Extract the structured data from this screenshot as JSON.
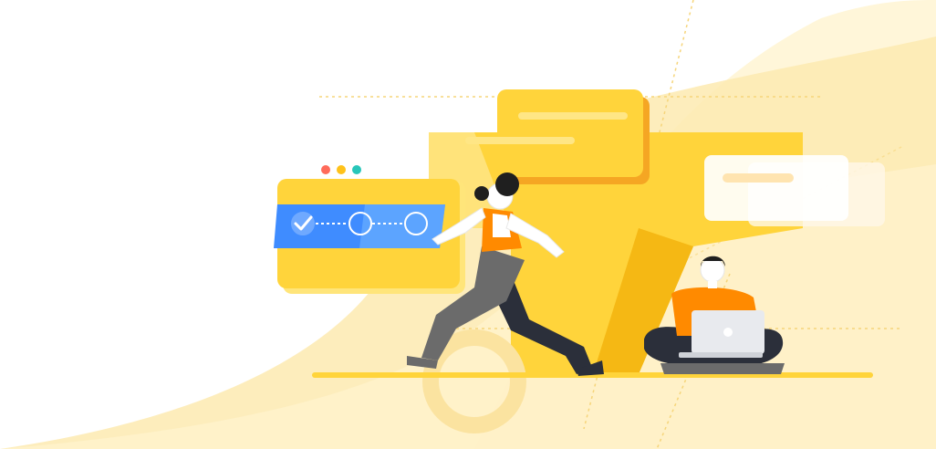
{
  "scene": {
    "description_free": true,
    "palette": {
      "background": "#ffffff",
      "wave_light": "#fff6d9",
      "wave_mid": "#fdeab0",
      "yellow_main": "#ffd43b",
      "yellow_dark": "#f5b814",
      "orange": "#ff8a00",
      "progress_blue": "#3f8cff",
      "progress_blue_light": "#6aaeff",
      "pants_gray": "#6b6b6b",
      "pants_dark": "#2b2f3a",
      "hair": "#1f1f1f",
      "skin": "#ffffff",
      "laptop": "#e8eaee",
      "dot_red": "#ff6b5a",
      "dot_yellow": "#ffc21a",
      "dot_teal": "#27c6b9"
    },
    "progress_widget": {
      "steps_total": 3,
      "steps_completed": 1
    },
    "window_dots": [
      "dot_red",
      "dot_yellow",
      "dot_teal"
    ],
    "icons": [
      "check-icon",
      "step-circle-icon"
    ]
  }
}
